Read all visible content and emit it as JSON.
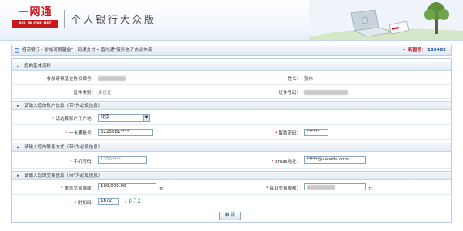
{
  "header": {
    "logo_cn": "一网通",
    "logo_en": "ALL IN ONE NET",
    "title": "个人银行大众版"
  },
  "breadcrumb": {
    "text": "招商银行 - 参加哥根基金\"一网通支付 • 直付通\"服务电子协议申请",
    "order_label": "新国号：",
    "order_number": "103402"
  },
  "sections": {
    "basic": "您的基本资料",
    "account": "请输入您的账户信息（带*为必填信息）",
    "contact": "请输入您的联系方式（带*为必填信息）",
    "transaction": "请输入您的交易信息（带*为必填信息）"
  },
  "basic": {
    "agreement_label": "参加哥根基金协议编号：",
    "name_label": "姓名：",
    "name_value": "张伟",
    "id_type_label": "证件类别：",
    "id_type_value": "身份证",
    "id_number_label": "证件号码："
  },
  "account": {
    "city_label": "请选择账户开户地：",
    "city_value": "北京",
    "card_label": "一卡通账号：",
    "card_value": "6225881****",
    "password_label": "取款密码：",
    "password_value": "******"
  },
  "contact": {
    "mobile_label": "手机号码：",
    "mobile_value": "1350****",
    "email_label": "Email地址：",
    "email_value": "*****@aateda.com"
  },
  "transaction": {
    "single_limit_label": "单笔交易限额：",
    "single_limit_value": "100,000.00",
    "unit": "元",
    "daily_limit_label": "每日交易限额：",
    "captcha_label": "附加码：",
    "captcha_input": "1872",
    "captcha_image": "1872"
  },
  "submit_label": "申 请",
  "colors": {
    "brand_red": "#c8171b",
    "section_bg": "#e2ebf5",
    "border": "#b9cde0"
  }
}
